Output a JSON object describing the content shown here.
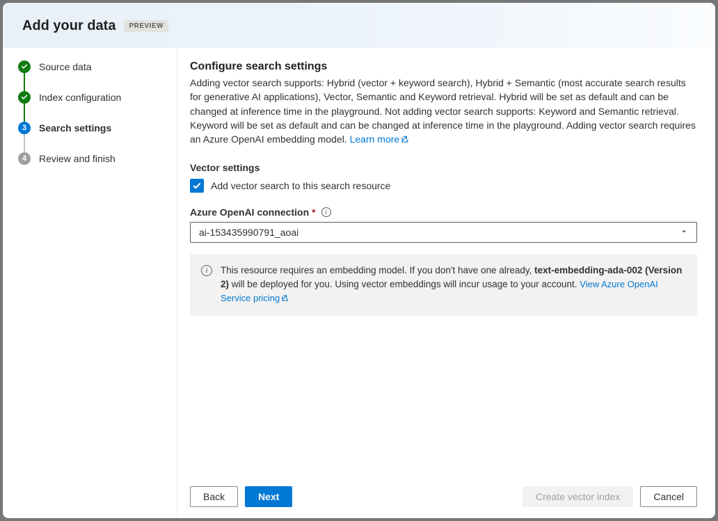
{
  "header": {
    "title": "Add your data",
    "badge": "PREVIEW"
  },
  "steps": [
    {
      "label": "Source data",
      "state": "done"
    },
    {
      "label": "Index configuration",
      "state": "done"
    },
    {
      "label": "Search settings",
      "state": "active",
      "number": "3"
    },
    {
      "label": "Review and finish",
      "state": "pending",
      "number": "4"
    }
  ],
  "main": {
    "title": "Configure search settings",
    "description": "Adding vector search supports: Hybrid (vector + keyword search), Hybrid + Semantic (most accurate search results for generative AI applications), Vector, Semantic and Keyword retrieval. Hybrid will be set as default and can be changed at inference time in the playground. Not adding vector search supports: Keyword and Semantic retrieval. Keyword will be set as default and can be changed at inference time in the playground. Adding vector search requires an Azure OpenAI embedding model. ",
    "learn_more": "Learn more",
    "vector_title": "Vector settings",
    "checkbox_label": "Add vector search to this search resource",
    "connection_label": "Azure OpenAI connection",
    "connection_value": "ai-153435990791_aoai",
    "info_text_pre": "This resource requires an embedding model. If you don't have one already, ",
    "info_text_bold": "text-embedding-ada-002 (Version 2)",
    "info_text_post": " will be deployed for you. Using vector embeddings will incur usage to your account. ",
    "pricing_link": "View Azure OpenAI Service pricing"
  },
  "footer": {
    "back": "Back",
    "next": "Next",
    "create": "Create vector index",
    "cancel": "Cancel"
  }
}
